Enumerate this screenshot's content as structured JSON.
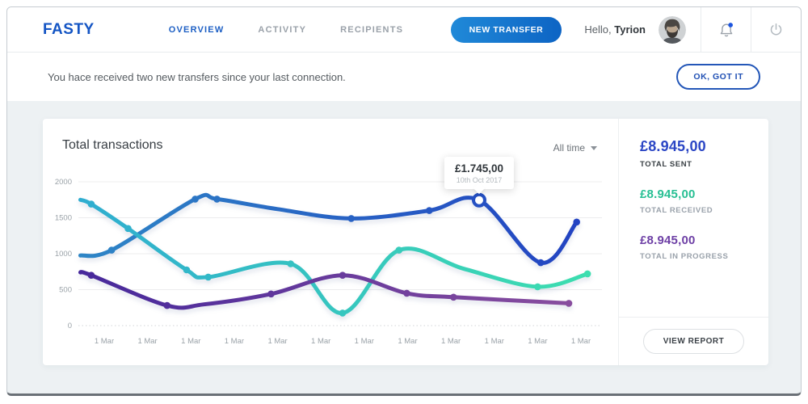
{
  "header": {
    "logo": "FASTY",
    "nav": [
      {
        "label": "OVERVIEW",
        "active": true
      },
      {
        "label": "ACTIVITY",
        "active": false
      },
      {
        "label": "RECIPIENTS",
        "active": false
      }
    ],
    "new_transfer_label": "NEW TRANSFER",
    "greeting": "Hello,",
    "username": "Tyrion",
    "notification_dot_color": "#1c55e0"
  },
  "banner": {
    "message": "You hace received two new transfers since your last connection.",
    "dismiss_label": "OK, GOT IT"
  },
  "chart_data": {
    "type": "line",
    "title": "Total transactions",
    "range_filter": "All time",
    "x_categories": [
      "1 Mar",
      "1 Mar",
      "1 Mar",
      "1 Mar",
      "1 Mar",
      "1 Mar",
      "1 Mar",
      "1 Mar",
      "1 Mar",
      "1 Mar",
      "1 Mar",
      "1 Mar"
    ],
    "y_ticks": [
      2000,
      1500,
      1000,
      500,
      0
    ],
    "ylim": [
      0,
      2000
    ],
    "grid": true,
    "tooltip": {
      "value": "£1.745,00",
      "date": "10th Oct 2017"
    },
    "series": [
      {
        "name": "Total sent",
        "color_from": "#2e86c6",
        "color_to": "#2240c2",
        "points": [
          [
            -0.55,
            975
          ],
          [
            0.17,
            1050
          ],
          [
            2.1,
            1760
          ],
          [
            2.6,
            1760
          ],
          [
            4,
            1620
          ],
          [
            5.7,
            1490
          ],
          [
            7.5,
            1600
          ],
          [
            8.65,
            1745
          ],
          [
            10.07,
            875
          ],
          [
            10.9,
            1440
          ]
        ],
        "marker_indices": [
          1,
          2,
          3,
          5,
          6,
          8,
          9
        ],
        "highlight_index": 7
      },
      {
        "name": "Total received",
        "color_from": "#2fadd0",
        "color_to": "#3ddfae",
        "points": [
          [
            -0.55,
            1750
          ],
          [
            -0.3,
            1690
          ],
          [
            0.55,
            1350
          ],
          [
            1.9,
            775
          ],
          [
            2.4,
            675
          ],
          [
            4.3,
            860
          ],
          [
            5.5,
            175
          ],
          [
            6.8,
            1050
          ],
          [
            8.3,
            790
          ],
          [
            10,
            540
          ],
          [
            11.15,
            720
          ]
        ],
        "marker_indices": [
          1,
          2,
          3,
          4,
          5,
          6,
          7,
          9,
          10
        ]
      },
      {
        "name": "Total in progress",
        "color_from": "#46289b",
        "color_to": "#8c4f9e",
        "points": [
          [
            -0.55,
            740
          ],
          [
            -0.3,
            700
          ],
          [
            1.45,
            280
          ],
          [
            2.3,
            295
          ],
          [
            3.85,
            440
          ],
          [
            5.5,
            700
          ],
          [
            6.98,
            450
          ],
          [
            8.06,
            395
          ],
          [
            10.72,
            310
          ]
        ],
        "marker_indices": [
          1,
          2,
          4,
          5,
          6,
          7,
          8
        ]
      }
    ]
  },
  "summary": {
    "items": [
      {
        "value": "£8.945,00",
        "label": "TOTAL SENT",
        "color": "#2b46c5"
      },
      {
        "value": "£8.945,00",
        "label": "TOTAL RECEIVED",
        "color": "#27bf93"
      },
      {
        "value": "£8.945,00",
        "label": "TOTAL IN PROGRESS",
        "color": "#6d3fa5"
      }
    ],
    "view_report_label": "VIEW REPORT"
  }
}
